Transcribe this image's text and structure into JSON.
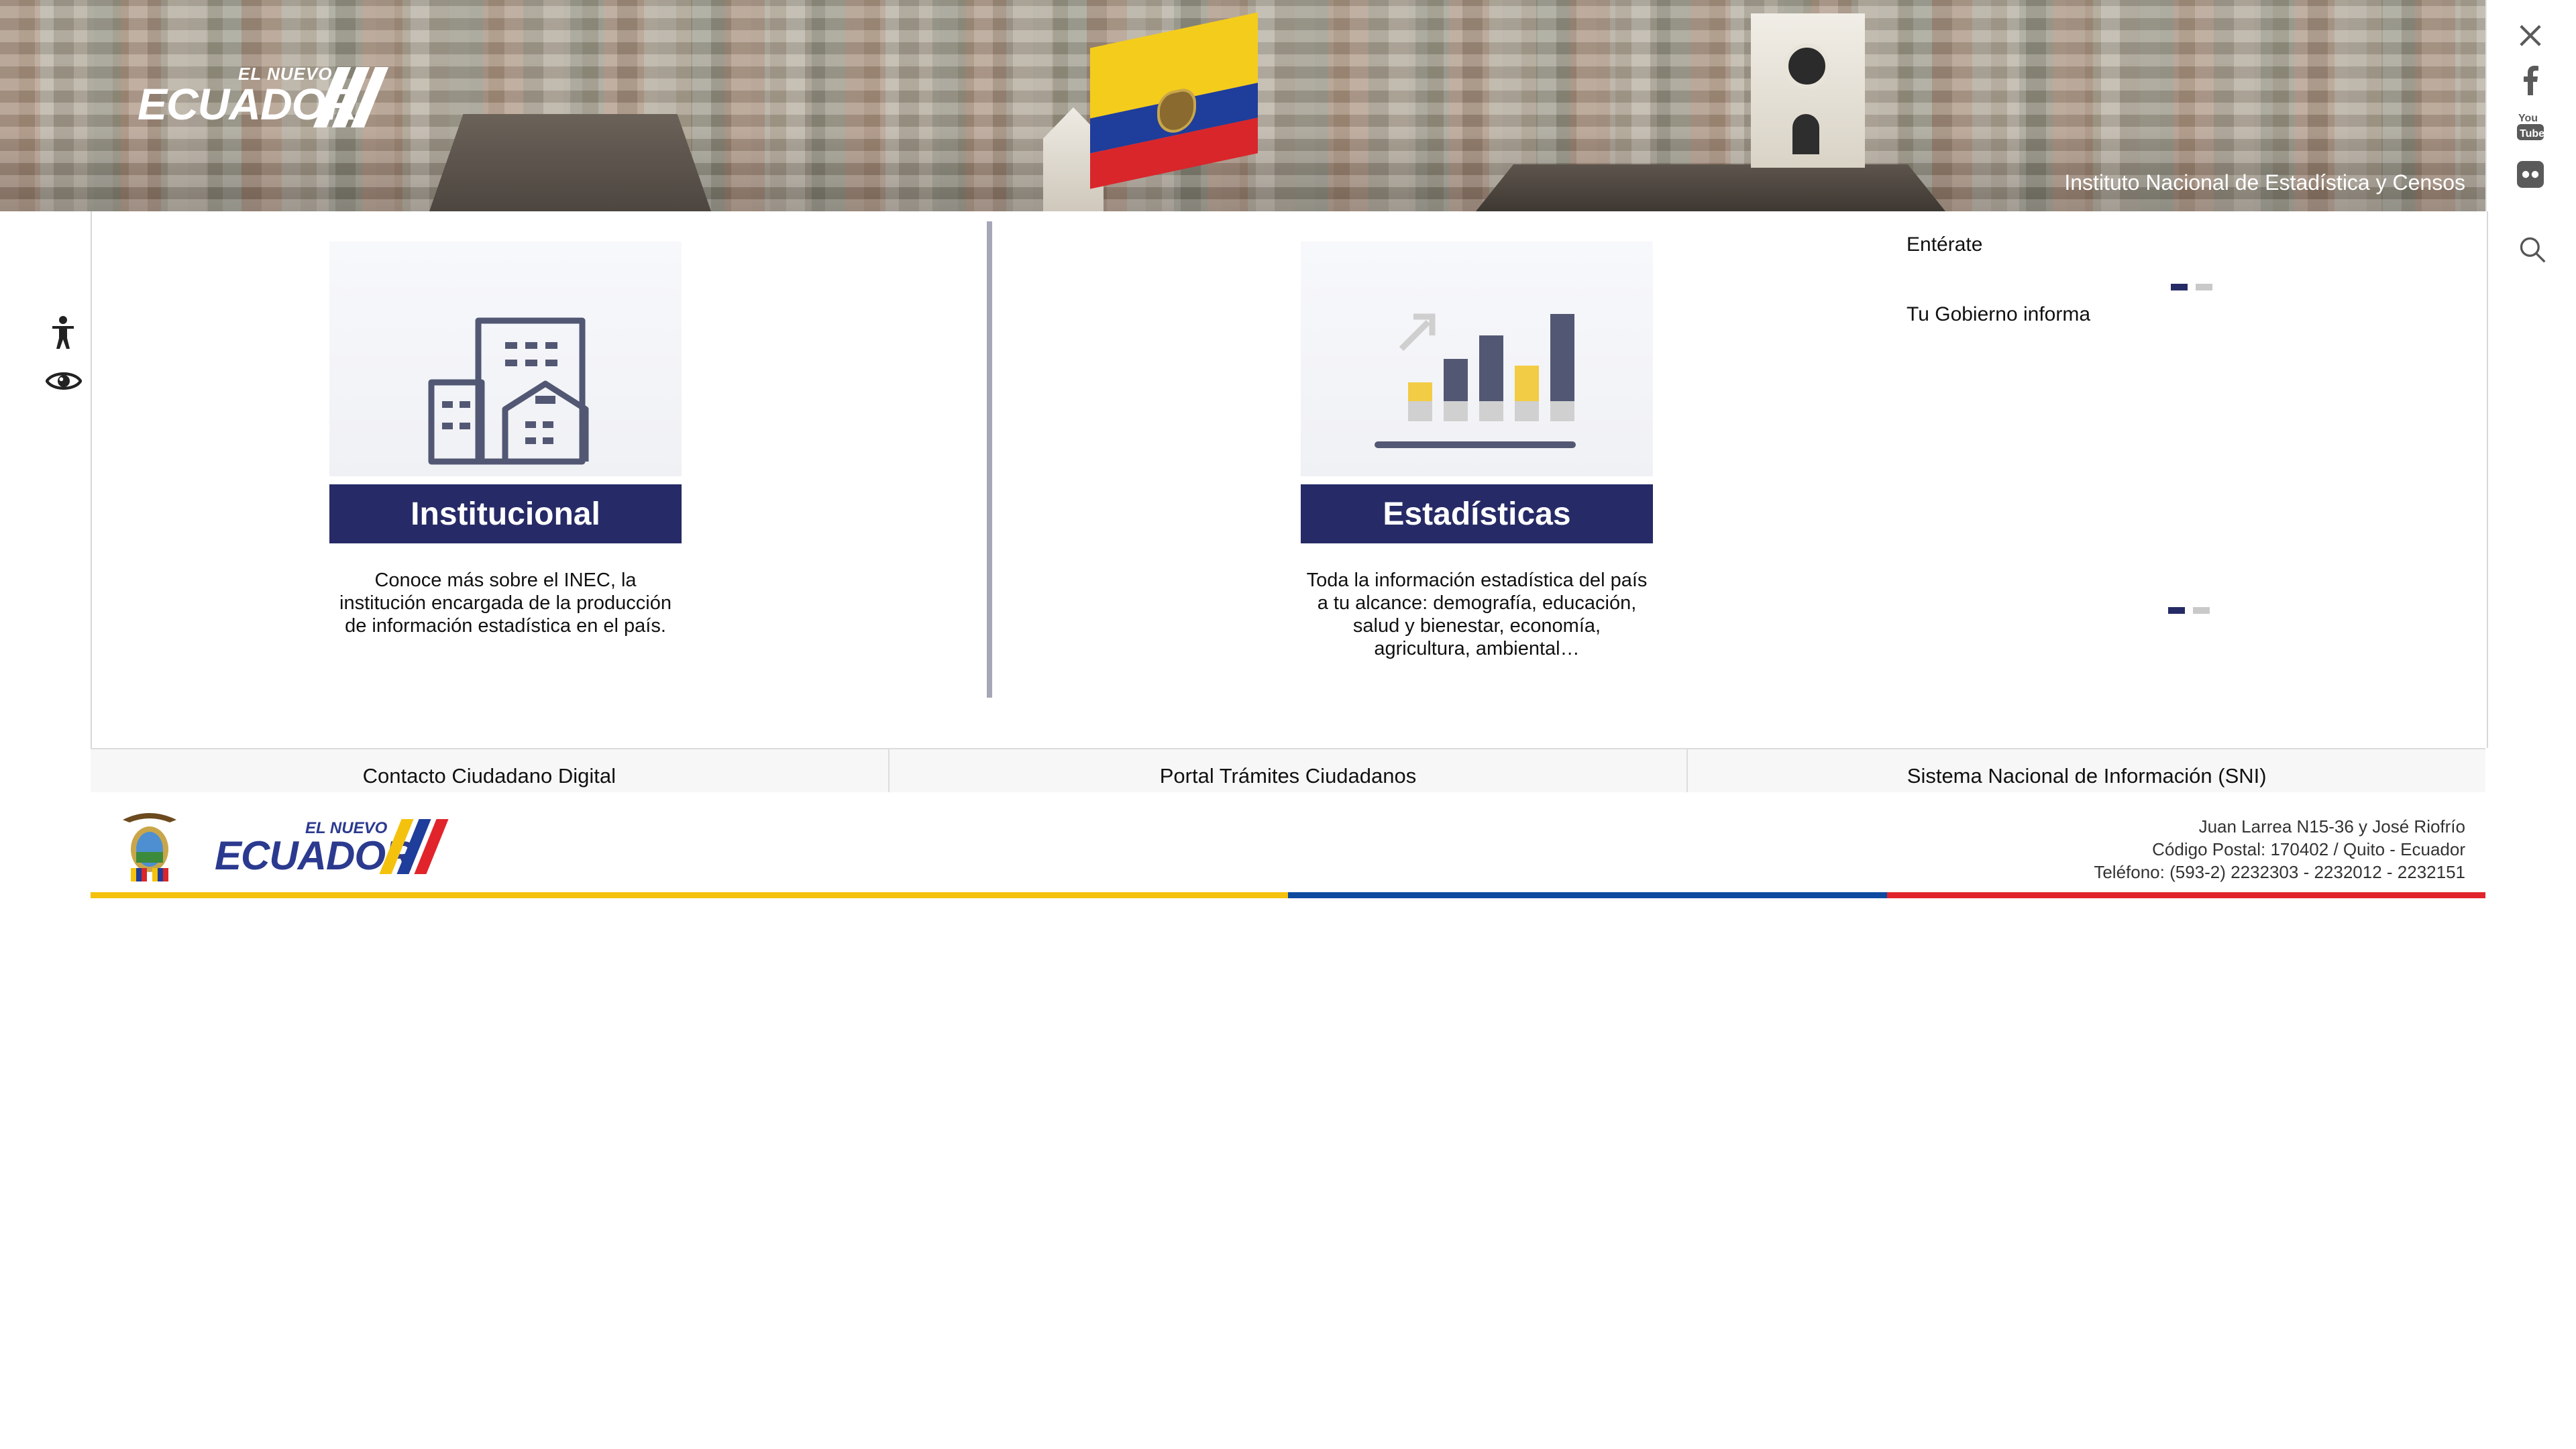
{
  "header": {
    "logo_small": "EL NUEVO",
    "logo_big": "ECUADOR",
    "site_title": "Instituto Nacional de Estadística y Censos"
  },
  "social": {
    "icons": [
      "x-icon",
      "facebook-icon",
      "youtube-icon",
      "flickr-icon"
    ],
    "youtube_label": "You Tube"
  },
  "accessibility": {
    "icons": [
      "accessibility-person-icon",
      "eye-icon"
    ]
  },
  "cards": [
    {
      "title": "Institucional",
      "description": "Conoce más sobre el INEC, la institución encargada de la producción de información estadística en el país."
    },
    {
      "title": "Estadísticas",
      "description": "Toda la información estadística del país a tu alcance: demografía, educación, salud y bienestar, economía, agricultura, ambiental…"
    }
  ],
  "news": {
    "enterate": "Entérate",
    "gobierno": "Tu Gobierno informa"
  },
  "quick_links": [
    "Contacto Ciudadano Digital",
    "Portal Trámites Ciudadanos",
    "Sistema Nacional de Información (SNI)"
  ],
  "footer": {
    "logo_small": "EL NUEVO",
    "logo_big": "ECUADOR",
    "address_line1": "Juan Larrea N15-36 y José Riofrío",
    "address_line2": "Código Postal: 170402 / Quito - Ecuador",
    "address_line3": "Teléfono: (593-2) 2232303 - 2232012 - 2232151"
  },
  "colors": {
    "brand_navy": "#262a66",
    "flag_yellow": "#f4c20d",
    "flag_blue": "#0e4aa0",
    "flag_red": "#e1242b"
  }
}
